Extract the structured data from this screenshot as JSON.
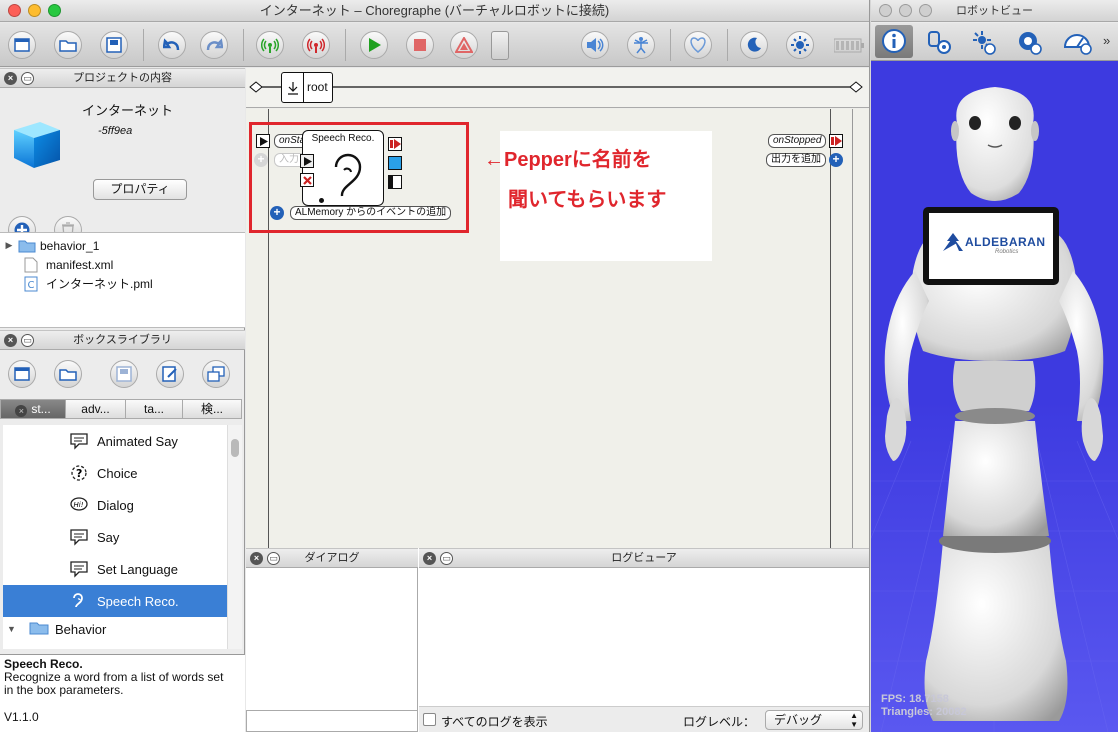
{
  "main_window": {
    "title": "インターネット – Choregraphe (バーチャルロボットに接続)"
  },
  "project_panel": {
    "header": "プロジェクトの内容",
    "project_name": "インターネット",
    "project_id": "-5ff9ea",
    "properties_button": "プロパティ",
    "files": [
      {
        "name": "behavior_1",
        "type": "folder"
      },
      {
        "name": "manifest.xml",
        "type": "file"
      },
      {
        "name": "インターネット.pml",
        "type": "pml"
      }
    ]
  },
  "box_library": {
    "header": "ボックスライブラリ",
    "tabs": [
      "st...",
      "adv...",
      "ta...",
      "検..."
    ],
    "items": [
      {
        "label": "Animated Say",
        "icon": "speech-bubble-icon"
      },
      {
        "label": "Choice",
        "icon": "question-icon"
      },
      {
        "label": "Dialog",
        "icon": "hi-bubble-icon"
      },
      {
        "label": "Say",
        "icon": "speech-bubble-icon"
      },
      {
        "label": "Set Language",
        "icon": "speech-bubble-icon"
      },
      {
        "label": "Speech Reco.",
        "icon": "ear-icon",
        "selected": true
      },
      {
        "label": "Behavior",
        "icon": "folder-icon"
      }
    ],
    "description_title": "Speech Reco.",
    "description_text": "Recognize a word from a list of words set in the box parameters.",
    "version": "V1.1.0"
  },
  "flow": {
    "breadcrumb_root": "root",
    "box_title": "Speech Reco.",
    "input_onstart": "onStart",
    "add_input": "入力を追加",
    "add_memory_event": "ALMemory からのイベントの追加",
    "output_onstopped": "onStopped",
    "add_output": "出力を追加",
    "annotation_line1": "←Pepperに名前を",
    "annotation_line2": "聞いてもらいます"
  },
  "dialog_panel": {
    "header": "ダイアログ"
  },
  "log_panel": {
    "header": "ログビューア",
    "show_all": "すべてのログを表示",
    "level_label": "ログレベル：",
    "level_value": "デバッグ"
  },
  "robot_window": {
    "title": "ロボットビュー",
    "tablet_brand": "ALDEBARAN",
    "tablet_sub": "Robotics",
    "fps": "FPS: 18.7158",
    "triangles": "Triangles: 20082"
  },
  "colors": {
    "selection": "#3a7fd5",
    "annotation_red": "#e0262d",
    "robot_bg": "#3d3ae0"
  }
}
